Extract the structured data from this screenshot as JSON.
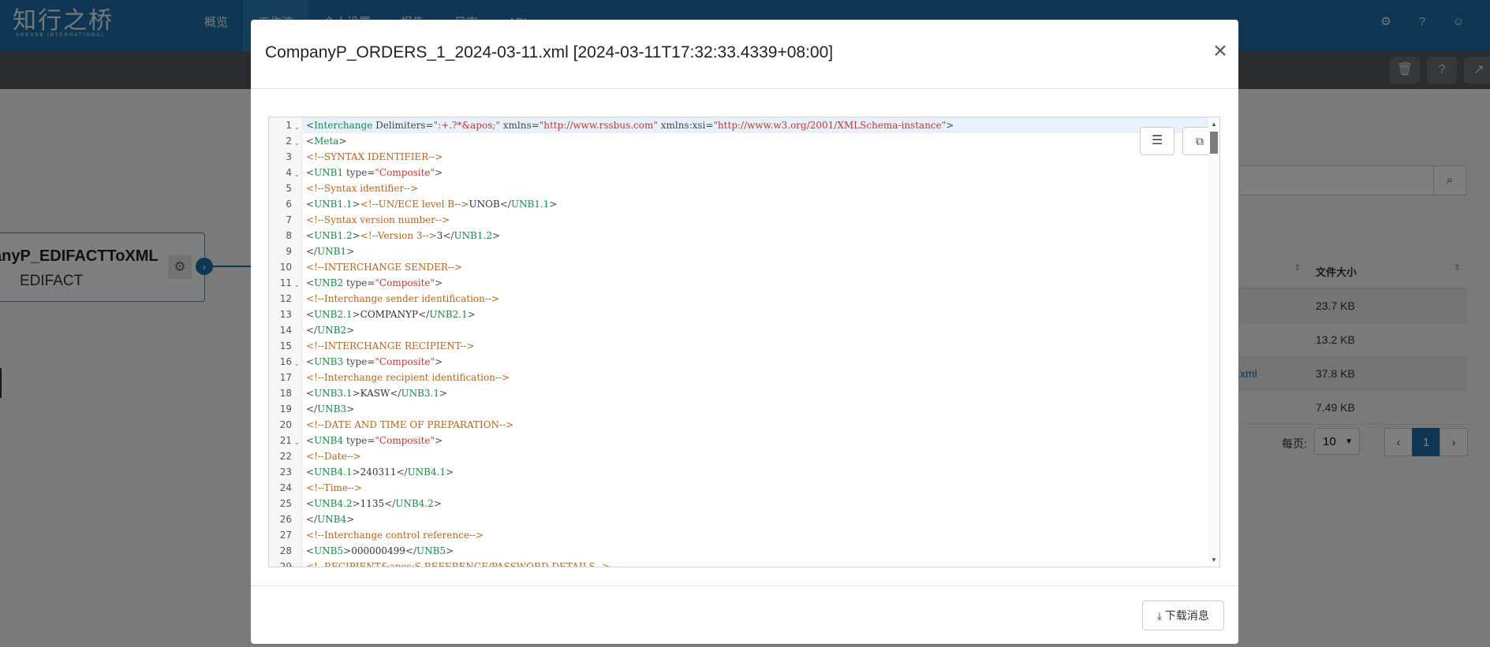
{
  "app": {
    "logo_text": "知行之桥",
    "logo_subtext": "ARESSB INTERNATIONAL",
    "nav": [
      "概览",
      "工作流",
      "个人设置",
      "报告",
      "日志",
      "API"
    ],
    "top_icons": [
      "gear-icon",
      "help-icon",
      "user-icon"
    ]
  },
  "flow_node": {
    "title": "anyP_EDIFACTToXML",
    "subtitle": "EDIFACT"
  },
  "file_table": {
    "header_size": "文件大小",
    "rows": [
      {
        "name": "",
        "size": "23.7 KB"
      },
      {
        "name": "",
        "size": "13.2 KB"
      },
      {
        "name": "l.xml",
        "size": "37.8 KB"
      },
      {
        "name": "",
        "size": "7.49 KB"
      }
    ],
    "page_size_label": "每页:",
    "page_size_value": "10",
    "current_page": "1"
  },
  "modal": {
    "title": "CompanyP_ORDERS_1_2024-03-11.xml [2024-03-11T17:32:33.4339+08:00]",
    "close_symbol": "×",
    "download_label": "下载消息",
    "code_lines": [
      {
        "n": "1",
        "fold": true,
        "t": [
          [
            "p",
            "<"
          ],
          [
            "tag",
            "Interchange"
          ],
          [
            "attr",
            " Delimiters="
          ],
          [
            "str",
            "\":+.?*&apos;\""
          ],
          [
            "attr",
            " xmlns="
          ],
          [
            "str",
            "\"http://www.rssbus.com\""
          ],
          [
            "attr",
            " xmlns:xsi="
          ],
          [
            "str",
            "\"http://www.w3.org/2001/XMLSchema-instance\""
          ],
          [
            "p",
            ">"
          ]
        ]
      },
      {
        "n": "2",
        "fold": true,
        "t": [
          [
            "p",
            "<"
          ],
          [
            "tag",
            "Meta"
          ],
          [
            "p",
            ">"
          ]
        ]
      },
      {
        "n": "3",
        "fold": false,
        "t": [
          [
            "com",
            "<!--SYNTAX IDENTIFIER-->"
          ]
        ]
      },
      {
        "n": "4",
        "fold": true,
        "t": [
          [
            "p",
            "<"
          ],
          [
            "tag",
            "UNB1"
          ],
          [
            "attr",
            " type="
          ],
          [
            "str",
            "\"Composite\""
          ],
          [
            "p",
            ">"
          ]
        ]
      },
      {
        "n": "5",
        "fold": false,
        "t": [
          [
            "com",
            "<!--Syntax identifier-->"
          ]
        ]
      },
      {
        "n": "6",
        "fold": false,
        "t": [
          [
            "p",
            "<"
          ],
          [
            "tag",
            "UNB1.1"
          ],
          [
            "p",
            ">"
          ],
          [
            "com",
            "<!--UN/ECE level B-->"
          ],
          [
            "txt",
            "UNOB"
          ],
          [
            "p",
            "</"
          ],
          [
            "tag",
            "UNB1.1"
          ],
          [
            "p",
            ">"
          ]
        ]
      },
      {
        "n": "7",
        "fold": false,
        "t": [
          [
            "com",
            "<!--Syntax version number-->"
          ]
        ]
      },
      {
        "n": "8",
        "fold": false,
        "t": [
          [
            "p",
            "<"
          ],
          [
            "tag",
            "UNB1.2"
          ],
          [
            "p",
            ">"
          ],
          [
            "com",
            "<!--Version 3-->"
          ],
          [
            "txt",
            "3"
          ],
          [
            "p",
            "</"
          ],
          [
            "tag",
            "UNB1.2"
          ],
          [
            "p",
            ">"
          ]
        ]
      },
      {
        "n": "9",
        "fold": false,
        "t": [
          [
            "p",
            "</"
          ],
          [
            "tag",
            "UNB1"
          ],
          [
            "p",
            ">"
          ]
        ]
      },
      {
        "n": "10",
        "fold": false,
        "t": [
          [
            "com",
            "<!--INTERCHANGE SENDER-->"
          ]
        ]
      },
      {
        "n": "11",
        "fold": true,
        "t": [
          [
            "p",
            "<"
          ],
          [
            "tag",
            "UNB2"
          ],
          [
            "attr",
            " type="
          ],
          [
            "str",
            "\"Composite\""
          ],
          [
            "p",
            ">"
          ]
        ]
      },
      {
        "n": "12",
        "fold": false,
        "t": [
          [
            "com",
            "<!--Interchange sender identification-->"
          ]
        ]
      },
      {
        "n": "13",
        "fold": false,
        "t": [
          [
            "p",
            "<"
          ],
          [
            "tag",
            "UNB2.1"
          ],
          [
            "p",
            ">"
          ],
          [
            "txt",
            "COMPANYP"
          ],
          [
            "p",
            "</"
          ],
          [
            "tag",
            "UNB2.1"
          ],
          [
            "p",
            ">"
          ]
        ]
      },
      {
        "n": "14",
        "fold": false,
        "t": [
          [
            "p",
            "</"
          ],
          [
            "tag",
            "UNB2"
          ],
          [
            "p",
            ">"
          ]
        ]
      },
      {
        "n": "15",
        "fold": false,
        "t": [
          [
            "com",
            "<!--INTERCHANGE RECIPIENT-->"
          ]
        ]
      },
      {
        "n": "16",
        "fold": true,
        "t": [
          [
            "p",
            "<"
          ],
          [
            "tag",
            "UNB3"
          ],
          [
            "attr",
            " type="
          ],
          [
            "str",
            "\"Composite\""
          ],
          [
            "p",
            ">"
          ]
        ]
      },
      {
        "n": "17",
        "fold": false,
        "t": [
          [
            "com",
            "<!--Interchange recipient identification-->"
          ]
        ]
      },
      {
        "n": "18",
        "fold": false,
        "t": [
          [
            "p",
            "<"
          ],
          [
            "tag",
            "UNB3.1"
          ],
          [
            "p",
            ">"
          ],
          [
            "txt",
            "KASW"
          ],
          [
            "p",
            "</"
          ],
          [
            "tag",
            "UNB3.1"
          ],
          [
            "p",
            ">"
          ]
        ]
      },
      {
        "n": "19",
        "fold": false,
        "t": [
          [
            "p",
            "</"
          ],
          [
            "tag",
            "UNB3"
          ],
          [
            "p",
            ">"
          ]
        ]
      },
      {
        "n": "20",
        "fold": false,
        "t": [
          [
            "com",
            "<!--DATE AND TIME OF PREPARATION-->"
          ]
        ]
      },
      {
        "n": "21",
        "fold": true,
        "t": [
          [
            "p",
            "<"
          ],
          [
            "tag",
            "UNB4"
          ],
          [
            "attr",
            " type="
          ],
          [
            "str",
            "\"Composite\""
          ],
          [
            "p",
            ">"
          ]
        ]
      },
      {
        "n": "22",
        "fold": false,
        "t": [
          [
            "com",
            "<!--Date-->"
          ]
        ]
      },
      {
        "n": "23",
        "fold": false,
        "t": [
          [
            "p",
            "<"
          ],
          [
            "tag",
            "UNB4.1"
          ],
          [
            "p",
            ">"
          ],
          [
            "txt",
            "240311"
          ],
          [
            "p",
            "</"
          ],
          [
            "tag",
            "UNB4.1"
          ],
          [
            "p",
            ">"
          ]
        ]
      },
      {
        "n": "24",
        "fold": false,
        "t": [
          [
            "com",
            "<!--Time-->"
          ]
        ]
      },
      {
        "n": "25",
        "fold": false,
        "t": [
          [
            "p",
            "<"
          ],
          [
            "tag",
            "UNB4.2"
          ],
          [
            "p",
            ">"
          ],
          [
            "txt",
            "1135"
          ],
          [
            "p",
            "</"
          ],
          [
            "tag",
            "UNB4.2"
          ],
          [
            "p",
            ">"
          ]
        ]
      },
      {
        "n": "26",
        "fold": false,
        "t": [
          [
            "p",
            "</"
          ],
          [
            "tag",
            "UNB4"
          ],
          [
            "p",
            ">"
          ]
        ]
      },
      {
        "n": "27",
        "fold": false,
        "t": [
          [
            "com",
            "<!--Interchange control reference-->"
          ]
        ]
      },
      {
        "n": "28",
        "fold": false,
        "t": [
          [
            "p",
            "<"
          ],
          [
            "tag",
            "UNB5"
          ],
          [
            "p",
            ">"
          ],
          [
            "txt",
            "000000499"
          ],
          [
            "p",
            "</"
          ],
          [
            "tag",
            "UNB5"
          ],
          [
            "p",
            ">"
          ]
        ]
      },
      {
        "n": "29",
        "fold": false,
        "t": [
          [
            "com",
            "<!--RECIPIENT&apos;S REFERENCE/PASSWORD DETAILS-->"
          ]
        ]
      }
    ]
  },
  "colors": {
    "brand": "#1f6fa8",
    "xml_tag": "#1a8a4a",
    "xml_string": "#c0392b",
    "xml_comment": "#b5651d"
  }
}
